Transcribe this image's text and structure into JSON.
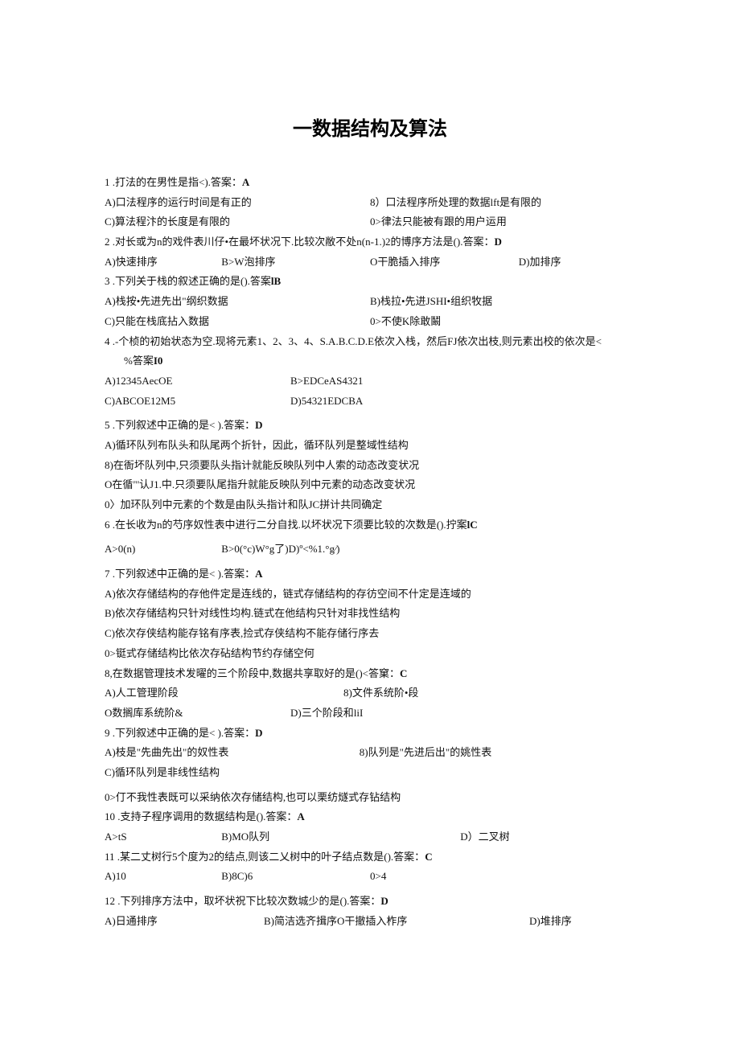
{
  "title": "一数据结构及算法",
  "q1": {
    "stem": "1 .打法的在男性是指<).答案：",
    "ans": "A",
    "a": "A)口法程序的运行时间是有正的",
    "b": "8）口法程序所处理的数据lft是有限的",
    "c": "C)算法程汴的长度是有限的",
    "d": "0>律法只能被有跟的用户运用"
  },
  "q2": {
    "stem": "2 .对长或为n的戏件表川仔•在最坏状况下.比较次敝不处n(n-1.)2的博序方法是().答案：",
    "ans": "D",
    "a": "A)快速排序",
    "b": "B>W泡排序",
    "c": "O干脆插入排序",
    "d": "D)加排序"
  },
  "q3": {
    "stem": "3 .下列关于栈的叙述正确的是().答案",
    "ans": "lB",
    "a": "A)栈按•先进先出\"纲织数据",
    "b": "B)栈拉•先进JSHI•组织牧据",
    "c": "C)只能在栈底拈入数据",
    "d": "0>不使K除敢鬫"
  },
  "q4": {
    "stem": "4 .-个桢的初始状态为空.现将元素1、2、3、4、S.A.B.C.D.E依次入栈，然后FJ依次出枝,则元素出校的依次是<",
    "stem2": "%答案",
    "ans": "I0",
    "a": "A)12345AecOE",
    "b": "B>EDCeAS4321",
    "c": "C)ABCOE12M5",
    "d": "D)54321EDCBA"
  },
  "q5": {
    "stem": "5 .下列叙述中正确的是< ).答案：",
    "ans": "D",
    "a": "A)循环队列布队头和队尾两个折针，因此，循环队列是整域性结构",
    "b": "8)在衙坏队列中,只须要队头指计就能反映队列中人索的动态改变状况",
    "c": "O在循\"'认J1.中.只须要队尾指升就能反映队列中元素的动态改变状况",
    "d": "0〉加环队列中元素的个数是由队头指计和队JC拼计共同确定"
  },
  "q6": {
    "stem": "6 .在长收为n的芍序奴性表中进行二分自找.以坏状况下须要比较的次数是().拧案",
    "ans": "lC",
    "a": "A>0(n)",
    "b": "B>0(°c)W°g了)D)º<%1.°g∕)"
  },
  "q7": {
    "stem": "7 .下列叙述中正确的是< ).答案：",
    "ans": "A",
    "a": "A)依次存储结构的存他件定是连线的，链式存储结构的存彷空间不什定是连域的",
    "b": "B)依次存储结构只针对线性均构.链式在他结构只针对非找性结构",
    "c": "C)依次存侠结构能存铭有序表,捡式存侠结构不能存储行序去",
    "d": "0>铤式存储结构比依次存砧结构节约存储空何"
  },
  "q8": {
    "stem": "8,在数据管理技术发曜的三个阶段中,数据共享取好的是()<答窠：",
    "ans": "C",
    "a": "A)人工管理阶段",
    "b": "8)文件系统阶•段",
    "c": "O数搁库系统阶&",
    "d": "D)三个阶段和liI"
  },
  "q9": {
    "stem": "9 .下列叙述中正确的是< ).答案：",
    "ans": "D",
    "a": "A)枝是\"先曲先出\"的奴性表",
    "b": "8)队列是\"先进后出\"的姚性表",
    "c": "C)循环队列是非线性结构",
    "d": "0>仃不我性表既可以采纳依次存储结构,也可以栗纺燧式存钻结构"
  },
  "q10": {
    "stem": "10 .支持子程序调用的数据结构是().答案：",
    "ans": "A",
    "a": "A>tS",
    "b": "B)MO队列",
    "d": "D）二叉树"
  },
  "q11": {
    "stem": "11 .某二丈树行5个度为2的结点,则该二乂树中的叶子结点数是().答案：",
    "ans": "C",
    "a": "A)10",
    "b": "B)8C)6",
    "d": "0>4"
  },
  "q12": {
    "stem": "12 .下列排序方法中，取坏状祝下比较次数城少的是().答案：",
    "ans": "D",
    "a": "A)日通排序",
    "b": "B)简洁选齐揖序O干撤插入柞序",
    "d": "D)堆排序"
  }
}
